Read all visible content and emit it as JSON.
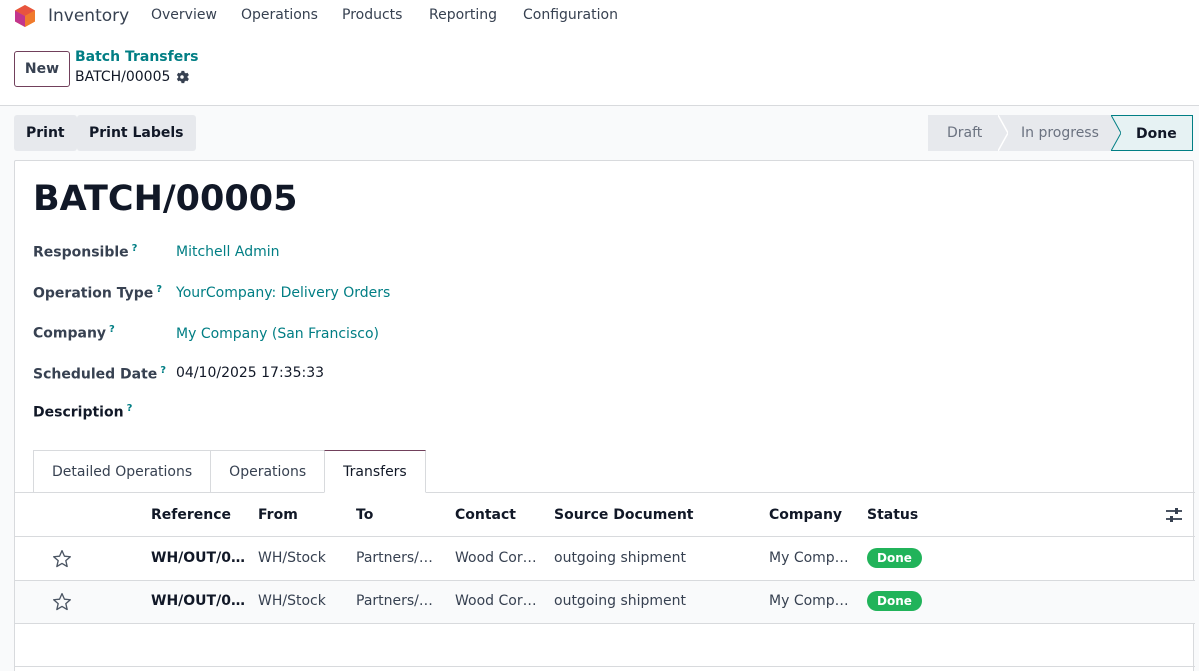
{
  "app": {
    "name": "Inventory"
  },
  "menu": [
    "Overview",
    "Operations",
    "Products",
    "Reporting",
    "Configuration"
  ],
  "control": {
    "new_label": "New",
    "breadcrumb_parent": "Batch Transfers",
    "breadcrumb_current": "BATCH/00005"
  },
  "actions": {
    "print": "Print",
    "print_labels": "Print Labels"
  },
  "status": {
    "stages": [
      "Draft",
      "In progress",
      "Done"
    ],
    "current": "Done"
  },
  "form": {
    "title": "BATCH/00005",
    "fields": {
      "responsible": {
        "label": "Responsible",
        "value": "Mitchell Admin"
      },
      "operation_type": {
        "label": "Operation Type",
        "value": "YourCompany: Delivery Orders"
      },
      "company": {
        "label": "Company",
        "value": "My Company (San Francisco)"
      },
      "scheduled_date": {
        "label": "Scheduled Date",
        "value": "04/10/2025 17:35:33"
      },
      "description": {
        "label": "Description"
      }
    },
    "help_mark": "?"
  },
  "tabs": [
    "Detailed Operations",
    "Operations",
    "Transfers"
  ],
  "active_tab": "Transfers",
  "table": {
    "headers": [
      "Reference",
      "From",
      "To",
      "Contact",
      "Source Document",
      "Company",
      "Status"
    ],
    "rows": [
      {
        "reference": "WH/OUT/0…",
        "from": "WH/Stock",
        "to": "Partners/…",
        "contact": "Wood Cor…",
        "source": "outgoing shipment",
        "company": "My Comp…",
        "status": "Done"
      },
      {
        "reference": "WH/OUT/0…",
        "from": "WH/Stock",
        "to": "Partners/…",
        "contact": "Wood Cor…",
        "source": "outgoing shipment",
        "company": "My Comp…",
        "status": "Done"
      }
    ]
  },
  "colors": {
    "accent": "#017e84",
    "brand": "#71405b",
    "success": "#21b35a"
  },
  "icons": [
    "app-logo-icon",
    "gear-icon",
    "star-icon",
    "optional-columns-icon"
  ]
}
